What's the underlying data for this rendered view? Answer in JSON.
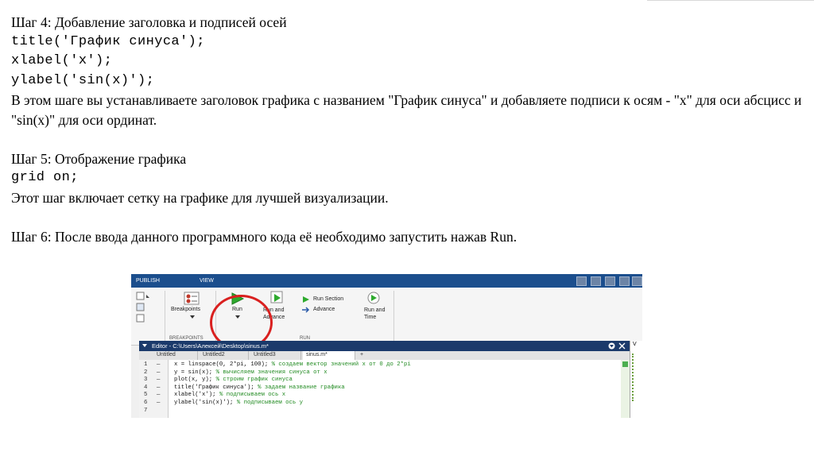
{
  "step4": {
    "heading": "Шаг 4: Добавление заголовка и подписей осей",
    "code": [
      "title('График синуса');",
      "xlabel('x');",
      "ylabel('sin(x)');"
    ],
    "description": "В этом шаге вы устанавливаете заголовок графика с названием \"График синуса\" и добавляете подписи к осям - \"x\" для оси абсцисс и \"sin(x)\" для оси ординат."
  },
  "step5": {
    "heading": "Шаг 5: Отображение графика",
    "code": "grid on;",
    "description": "Этот шаг включает сетку на графике для лучшей визуализации."
  },
  "step6": {
    "text": "Шаг 6: После ввода данного программного кода её необходимо запустить нажав Run."
  },
  "screenshot": {
    "ribbon_tabs": [
      "PUBLISH",
      "VIEW"
    ],
    "breakpoints_label": "Breakpoints",
    "breakpoints_section": "BREAKPOINTS",
    "run_label": "Run",
    "run_and_advance_label": [
      "Run and",
      "Advance"
    ],
    "run_section_label": "Run Section",
    "advance_label": "Advance",
    "run_and_time_label": [
      "Run and",
      "Time"
    ],
    "run_section": "RUN",
    "editor_title": "Editor - C:\\Users\\Алексей\\Desktop\\sinus.m*",
    "editor_tabs": [
      "Untitled",
      "Untitled2",
      "Untitled3",
      "sinus.m*",
      "+"
    ],
    "code_lines": [
      {
        "num": "1",
        "code": "x = linspace(0, 2*pi, 100);",
        "comment": "% создаем вектор значений x от 0 до 2*pi"
      },
      {
        "num": "2",
        "code": "y = sin(x);",
        "comment": "% вычисляем значения синуса от x"
      },
      {
        "num": "3",
        "code": "plot(x, y);",
        "comment": "% строим график синуса"
      },
      {
        "num": "4",
        "code": "title('График синуса');",
        "comment": "% задаем название графика"
      },
      {
        "num": "5",
        "code": "xlabel('x');",
        "comment": "% подписываем ось x"
      },
      {
        "num": "6",
        "code": "ylabel('sin(x)');",
        "comment": "% подписываем ось y"
      },
      {
        "num": "7",
        "code": "",
        "comment": ""
      }
    ],
    "right_panel_label": "V"
  },
  "colors": {
    "ribbon_blue": "#1b4e8d",
    "editor_bar": "#1b3a6b",
    "highlight_circle": "#d9201f",
    "comment_green": "#228b22",
    "run_green": "#2eaa2e"
  }
}
